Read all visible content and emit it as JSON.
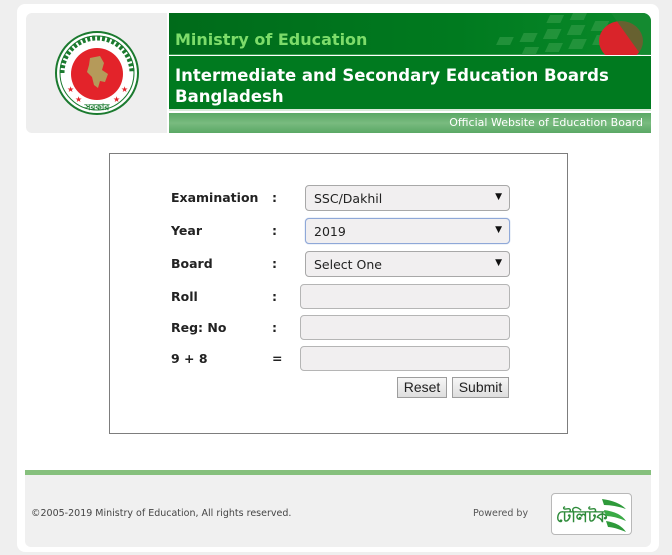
{
  "header": {
    "ministry": "Ministry of Education",
    "title": "Intermediate and Secondary Education Boards Bangladesh",
    "tagline": "Official Website of Education Board",
    "logo_icon": "government-seal-icon",
    "flag_icon": "bangladesh-flag-icon"
  },
  "form": {
    "fields": [
      {
        "label": "Examination",
        "sep": ":",
        "type": "select",
        "value": "SSC/Dakhil"
      },
      {
        "label": "Year",
        "sep": ":",
        "type": "select",
        "value": "2019"
      },
      {
        "label": "Board",
        "sep": ":",
        "type": "select",
        "value": "Select One"
      },
      {
        "label": "Roll",
        "sep": ":",
        "type": "text",
        "value": ""
      },
      {
        "label": "Reg: No",
        "sep": ":",
        "type": "text",
        "value": ""
      },
      {
        "label": "9 + 8",
        "sep": "=",
        "type": "text",
        "value": ""
      }
    ],
    "reset_label": "Reset",
    "submit_label": "Submit",
    "dropdown_arrow": "▼"
  },
  "footer": {
    "copyright": "©2005-2019 Ministry of Education, All rights reserved.",
    "powered_by": "Powered by",
    "partner_logo_text": "টেলিটক",
    "partner_icon": "teletalk-logo-icon"
  },
  "colors": {
    "brand_green": "#007a1f",
    "ministry_text": "#7ddc6a",
    "footer_bar": "#86c07d",
    "seal_red": "#e3232a"
  }
}
